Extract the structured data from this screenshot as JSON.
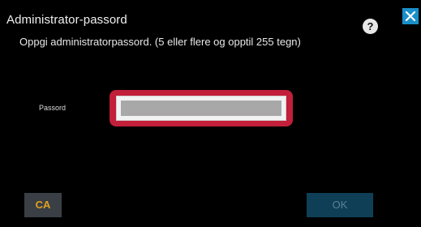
{
  "dialog": {
    "title": "Administrator-passord",
    "instruction": "Oppgi administratorpassord. (5 eller flere og opptil 255 tegn)",
    "help_label": "?",
    "close_icon": "close-icon"
  },
  "form": {
    "password_label": "Passord",
    "password_value": "",
    "password_placeholder": ""
  },
  "buttons": {
    "clear_all_label": "CA",
    "ok_label": "OK"
  },
  "colors": {
    "background": "#000000",
    "focus_border": "#c21f3a",
    "close_button": "#1a8fc9",
    "ca_text": "#e0a020",
    "ok_background_disabled": "#0f3f56"
  }
}
